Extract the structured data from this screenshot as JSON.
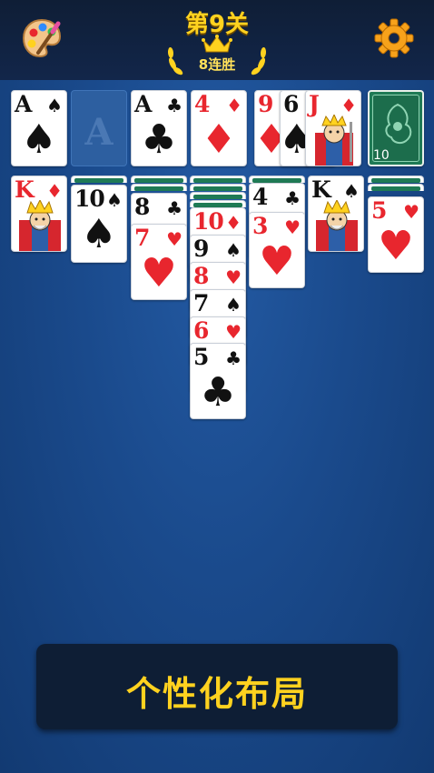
{
  "header": {
    "level_title": "第9关",
    "streak": "8连胜"
  },
  "icons": {
    "theme": "palette-icon",
    "settings": "gear-icon",
    "crown": "crown-icon",
    "laurel": "laurel-icon"
  },
  "colors": {
    "table": "#1a4a8c",
    "accent_gold": "#ffd21f",
    "card_red": "#e8262e",
    "card_back": "#1f7a55"
  },
  "foundations": [
    {
      "rank": "A",
      "suit": "♠",
      "color": "black"
    },
    {
      "rank": "A",
      "suit": "",
      "empty_slot": true
    },
    {
      "rank": "A",
      "suit": "♣",
      "color": "black"
    },
    {
      "rank": "4",
      "suit": "♦",
      "color": "red"
    }
  ],
  "waste": [
    {
      "rank": "9",
      "suit": "♦",
      "color": "red"
    },
    {
      "rank": "6",
      "suit": "♠",
      "color": "black"
    },
    {
      "rank": "J",
      "suit": "♦",
      "color": "red"
    }
  ],
  "stock": {
    "count": "10"
  },
  "tableau": {
    "col1": {
      "cards": [
        {
          "rank": "K",
          "suit": "♦"
        }
      ]
    },
    "col2": {
      "cards": [
        {
          "rank": "10",
          "suit": "♠"
        }
      ]
    },
    "col3": {
      "cards": [
        {
          "rank": "8",
          "suit": "♣"
        },
        {
          "rank": "7",
          "suit": "♥"
        }
      ]
    },
    "col4": {
      "cards": [
        {
          "rank": "10",
          "suit": "♦"
        },
        {
          "rank": "9",
          "suit": "♠"
        },
        {
          "rank": "8",
          "suit": "♥"
        },
        {
          "rank": "7",
          "suit": "♠"
        },
        {
          "rank": "6",
          "suit": "♥"
        },
        {
          "rank": "5",
          "suit": "♣"
        }
      ]
    },
    "col5": {
      "cards": [
        {
          "rank": "4",
          "suit": "♣"
        },
        {
          "rank": "3",
          "suit": "♥"
        }
      ]
    },
    "col6": {
      "cards": [
        {
          "rank": "K",
          "suit": "♠"
        }
      ]
    },
    "col7": {
      "cards": [
        {
          "rank": "5",
          "suit": "♥"
        }
      ]
    }
  },
  "banner": {
    "text": "个性化布局"
  }
}
